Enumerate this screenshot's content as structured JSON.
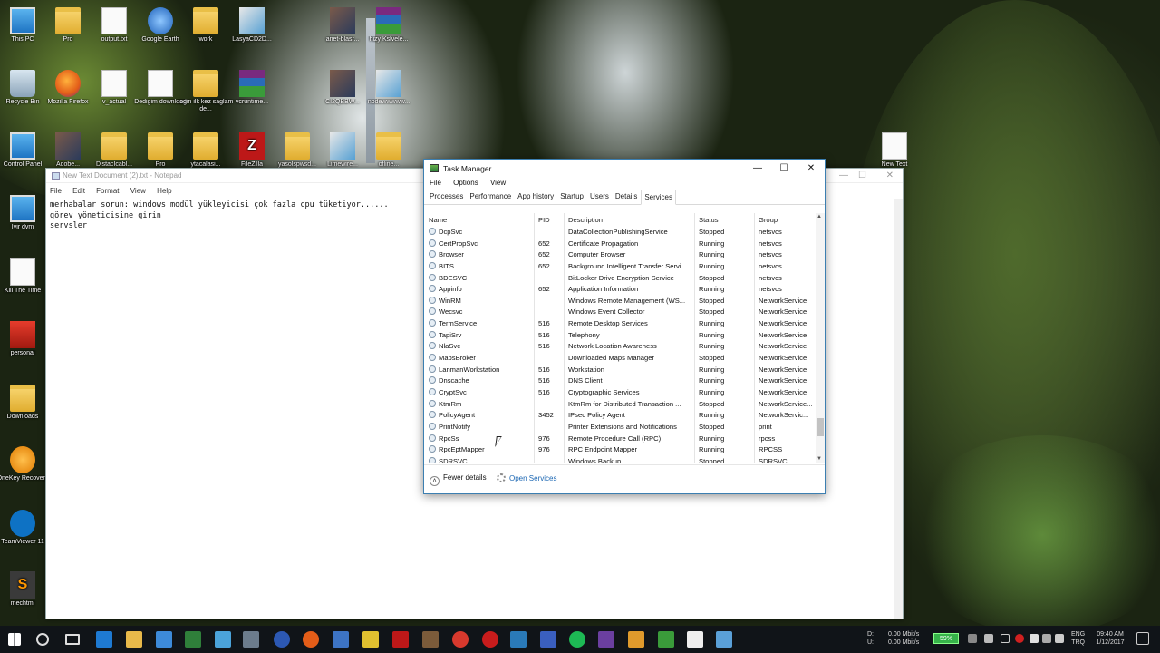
{
  "desktop": {
    "icons": [
      {
        "label": "This PC",
        "type": "pc"
      },
      {
        "label": "Pro",
        "type": "folder"
      },
      {
        "label": "output.txt",
        "type": "doc"
      },
      {
        "label": "Google Earth",
        "type": "google"
      },
      {
        "label": "work",
        "type": "folder"
      },
      {
        "label": "LasyaCD2D...",
        "type": "paint"
      },
      {
        "label": "anet-blasr...",
        "type": "photo"
      },
      {
        "label": "hizy Kslvele...",
        "type": "rar"
      },
      {
        "label": "Recycle Bin",
        "type": "bin"
      },
      {
        "label": "Mozilla Firefox",
        "type": "ff"
      },
      {
        "label": "v_actual",
        "type": "doc"
      },
      {
        "label": "Dedigim download",
        "type": "doc"
      },
      {
        "label": "login ilk kez saglam de...",
        "type": "folder"
      },
      {
        "label": "vcruntime...",
        "type": "rar"
      },
      {
        "label": "CI2QBBW...",
        "type": "photo"
      },
      {
        "label": "nodewwwww...",
        "type": "paint"
      },
      {
        "label": "Control Panel",
        "type": "pc"
      },
      {
        "label": "Adobe...",
        "type": "photo"
      },
      {
        "label": "DistacIcabl...",
        "type": "folder"
      },
      {
        "label": "Pro",
        "type": "folder"
      },
      {
        "label": "ytacalasi...",
        "type": "folder"
      },
      {
        "label": "FileZilla",
        "type": "fz"
      },
      {
        "label": "yasolspwsd...",
        "type": "folder"
      },
      {
        "label": "Limewire...",
        "type": "paint"
      },
      {
        "label": "ofline...",
        "type": "folder"
      },
      {
        "label": "New Text",
        "type": "doc"
      },
      {
        "label": "Ivir dvm",
        "type": "pc"
      },
      {
        "label": "Kill The Time",
        "type": "doc"
      },
      {
        "label": "personal",
        "type": "red"
      },
      {
        "label": "Downloads",
        "type": "folder"
      },
      {
        "label": "OneKey Recovery",
        "type": "onekey"
      },
      {
        "label": "TeamViewer 11",
        "type": "tv"
      },
      {
        "label": "mechtml",
        "type": "sub"
      }
    ]
  },
  "notepad": {
    "title": "New Text Document (2).txt - Notepad",
    "menu": [
      "File",
      "Edit",
      "Format",
      "View",
      "Help"
    ],
    "text": "merhabalar sorun: windows modül yükleyicisi çok fazla cpu tüketiyor......\ngörev yöneticisine girin\nservsler"
  },
  "taskmanager": {
    "title": "Task Manager",
    "menu": [
      "File",
      "Options",
      "View"
    ],
    "tabs": [
      "Processes",
      "Performance",
      "App history",
      "Startup",
      "Users",
      "Details",
      "Services"
    ],
    "active_tab": "Services",
    "columns": [
      "Name",
      "PID",
      "Description",
      "Status",
      "Group"
    ],
    "rows": [
      [
        "DcpSvc",
        "",
        "DataCollectionPublishingService",
        "Stopped",
        "netsvcs"
      ],
      [
        "CertPropSvc",
        "652",
        "Certificate Propagation",
        "Running",
        "netsvcs"
      ],
      [
        "Browser",
        "652",
        "Computer Browser",
        "Running",
        "netsvcs"
      ],
      [
        "BITS",
        "652",
        "Background Intelligent Transfer Servi...",
        "Running",
        "netsvcs"
      ],
      [
        "BDESVC",
        "",
        "BitLocker Drive Encryption Service",
        "Stopped",
        "netsvcs"
      ],
      [
        "Appinfo",
        "652",
        "Application Information",
        "Running",
        "netsvcs"
      ],
      [
        "WinRM",
        "",
        "Windows Remote Management (WS...",
        "Stopped",
        "NetworkService"
      ],
      [
        "Wecsvc",
        "",
        "Windows Event Collector",
        "Stopped",
        "NetworkService"
      ],
      [
        "TermService",
        "516",
        "Remote Desktop Services",
        "Running",
        "NetworkService"
      ],
      [
        "TapiSrv",
        "516",
        "Telephony",
        "Running",
        "NetworkService"
      ],
      [
        "NlaSvc",
        "516",
        "Network Location Awareness",
        "Running",
        "NetworkService"
      ],
      [
        "MapsBroker",
        "",
        "Downloaded Maps Manager",
        "Stopped",
        "NetworkService"
      ],
      [
        "LanmanWorkstation",
        "516",
        "Workstation",
        "Running",
        "NetworkService"
      ],
      [
        "Dnscache",
        "516",
        "DNS Client",
        "Running",
        "NetworkService"
      ],
      [
        "CryptSvc",
        "516",
        "Cryptographic Services",
        "Running",
        "NetworkService"
      ],
      [
        "KtmRm",
        "",
        "KtmRm for Distributed Transaction ...",
        "Stopped",
        "NetworkService..."
      ],
      [
        "PolicyAgent",
        "3452",
        "IPsec Policy Agent",
        "Running",
        "NetworkServic..."
      ],
      [
        "PrintNotify",
        "",
        "Printer Extensions and Notifications",
        "Stopped",
        "print"
      ],
      [
        "RpcSs",
        "976",
        "Remote Procedure Call (RPC)",
        "Running",
        "rpcss"
      ],
      [
        "RpcEptMapper",
        "976",
        "RPC Endpoint Mapper",
        "Running",
        "RPCSS"
      ],
      [
        "SDRSVC",
        "",
        "Windows Backup",
        "Stopped",
        "SDRSVC"
      ]
    ],
    "fewer_details": "Fewer details",
    "open_services": "Open Services"
  },
  "taskbar": {
    "network_down_label": "D:",
    "network_up_label": "U:",
    "down_speed": "0.00 Mbit/s",
    "up_speed": "0.00 Mbit/s",
    "battery": "59%",
    "language": "ENG",
    "region": "TRQ",
    "time": "09:40 AM",
    "date": "1/12/2017"
  }
}
